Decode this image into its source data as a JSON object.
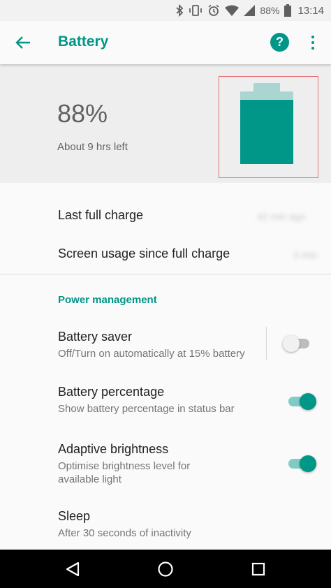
{
  "status_bar": {
    "battery_text": "88%",
    "time": "13:14",
    "icons": [
      "bluetooth-icon",
      "vibrate-icon",
      "alarm-icon",
      "wifi-icon",
      "signal-icon",
      "battery-icon"
    ]
  },
  "app_bar": {
    "title": "Battery",
    "help_label": "?"
  },
  "battery": {
    "percent": "88%",
    "time_left": "About 9 hrs left",
    "level": 0.88,
    "fill_color": "#009688",
    "empty_color": "#aad5d1"
  },
  "usage": {
    "last_full_charge": {
      "label": "Last full charge",
      "value": "42 min ago"
    },
    "screen_usage": {
      "label": "Screen usage since full charge",
      "value": "3 min"
    }
  },
  "power_management": {
    "header": "Power management",
    "battery_saver": {
      "title": "Battery saver",
      "subtitle": "Off/Turn on automatically at 15% battery",
      "enabled": false
    },
    "battery_percentage": {
      "title": "Battery percentage",
      "subtitle": "Show battery percentage in status bar",
      "enabled": true
    },
    "adaptive_brightness": {
      "title": "Adaptive brightness",
      "subtitle_line1": "Optimise brightness level for",
      "subtitle_line2": "available light",
      "enabled": true
    },
    "sleep": {
      "title": "Sleep",
      "subtitle": "After 30 seconds of inactivity"
    }
  },
  "colors": {
    "accent": "#009688",
    "accent_light": "#80cbc4"
  },
  "nav_bar": {
    "icons": [
      "back-icon",
      "home-icon",
      "recents-icon"
    ]
  }
}
